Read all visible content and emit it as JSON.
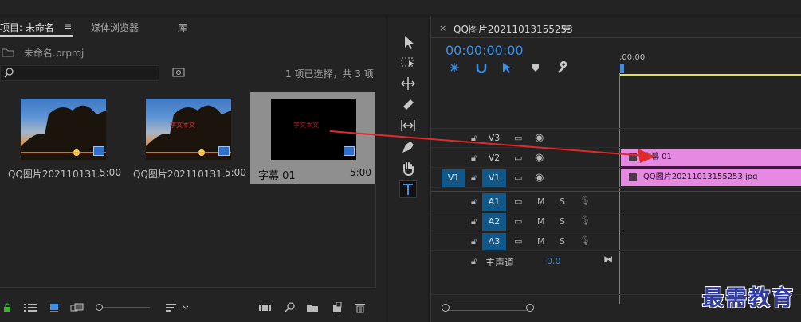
{
  "project_panel": {
    "tabs": [
      "项目: 未命名",
      "媒体浏览器",
      "库"
    ],
    "menu_icon": "hamburger-menu-icon",
    "project_file": "未命名.prproj",
    "search": {
      "value": "",
      "placeholder": ""
    },
    "selection_status": "1 项已选择，共 3 项",
    "items": [
      {
        "name": "QQ图片2021101З1...",
        "duration": "5:00"
      },
      {
        "name": "QQ图片2021101З1...",
        "duration": "5:00"
      },
      {
        "name": "字幕 01",
        "duration": "5:00"
      }
    ],
    "thumb_overlay_text": "字文本文"
  },
  "timeline": {
    "sequence_name": "QQ图片20211013155253",
    "timecode": "00:00:00:00",
    "ruler_label": ":00:00",
    "tracks": {
      "video": [
        "V3",
        "V2",
        "V1"
      ],
      "audio": [
        "A1",
        "A2",
        "A3"
      ],
      "source_v1": "V1",
      "master_label": "主声道",
      "master_value": "0.0",
      "mute": "M",
      "solo": "S"
    },
    "clips": [
      {
        "track": "V2",
        "name": "字幕 01"
      },
      {
        "track": "V1",
        "name": "QQ图片20211013155253.jpg"
      }
    ],
    "colors": {
      "accent_blue": "#3e8fe6",
      "clip_pink": "#e589e2",
      "track_blue": "#115889",
      "playhead": "#4e89d6",
      "work_area": "#e6e04c"
    }
  },
  "watermark": "最需教育"
}
